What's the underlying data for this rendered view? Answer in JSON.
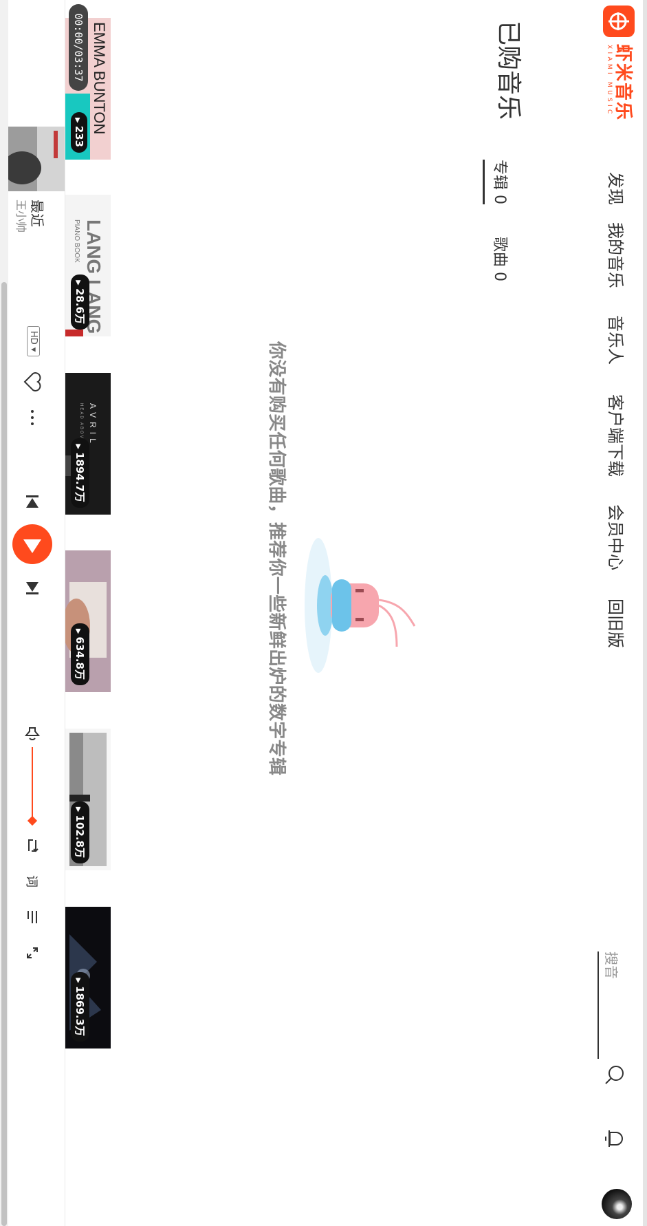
{
  "brand": {
    "name": "虾米音乐",
    "sub": "XIAMI MUSIC",
    "color": "#ff4a1d"
  },
  "nav": [
    {
      "label": "发现"
    },
    {
      "label": "我的音乐"
    },
    {
      "label": "音乐人"
    },
    {
      "label": "客户端下载"
    },
    {
      "label": "会员中心"
    },
    {
      "label": "回旧版"
    }
  ],
  "search": {
    "placeholder": "搜音"
  },
  "page": {
    "title": "已购音乐",
    "tabs": [
      {
        "label": "专辑 0",
        "active": true
      },
      {
        "label": "歌曲 0",
        "active": false
      }
    ],
    "empty_message": "你没有购买任何歌曲，推荐你一些新鲜出炉的数字专辑"
  },
  "albums": [
    {
      "count": "233",
      "cover_text": "EMMA BUNTON"
    },
    {
      "count": "28.6万",
      "cover_text": "LANG LANG",
      "cover_sub": "PIANO BOOK"
    },
    {
      "count": "1894.7万",
      "cover_text": "AVRIL",
      "cover_sub": "HEAD ABOVE WATER"
    },
    {
      "count": "634.8万"
    },
    {
      "count": "102.8万"
    },
    {
      "count": "1869.3万"
    }
  ],
  "player": {
    "timer": "00:00/03:37",
    "song_title": "最近",
    "artist": "王小帅",
    "quality": "HD",
    "volume_level": 1.0
  },
  "icons": [
    "search-icon",
    "bell-icon",
    "heart-icon",
    "more-icon",
    "prev-icon",
    "play-icon",
    "next-icon",
    "volume-icon",
    "repeat-icon",
    "lyrics-icon",
    "playlist-icon",
    "expand-icon"
  ]
}
